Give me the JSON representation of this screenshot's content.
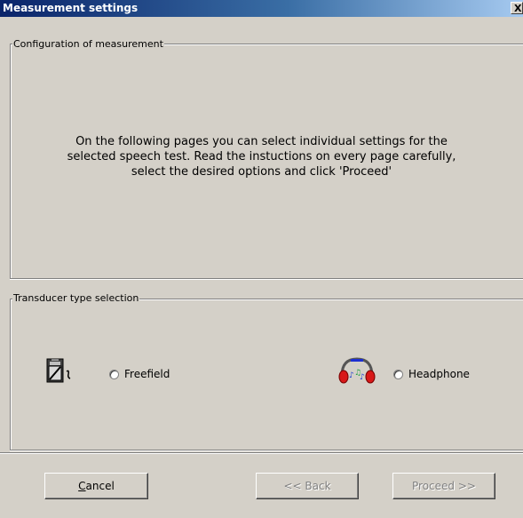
{
  "window": {
    "title": "Measurement settings",
    "close_glyph": "X"
  },
  "configuration": {
    "legend": "Configuration of measurement",
    "intro_line1": "On the following pages you can select individual settings for the",
    "intro_line2": "selected speech test. Read the instuctions on every page carefully,",
    "intro_line3": "select the desired options and click 'Proceed'"
  },
  "transducer": {
    "legend": "Transducer type selection",
    "options": [
      {
        "label": "Freefield",
        "icon": "loudspeaker-icon",
        "selected": false
      },
      {
        "label": "Headphone",
        "icon": "headphone-icon",
        "selected": false
      }
    ]
  },
  "buttons": {
    "cancel_first": "C",
    "cancel_rest": "ancel",
    "back": "<< Back",
    "proceed": "Proceed >>"
  }
}
